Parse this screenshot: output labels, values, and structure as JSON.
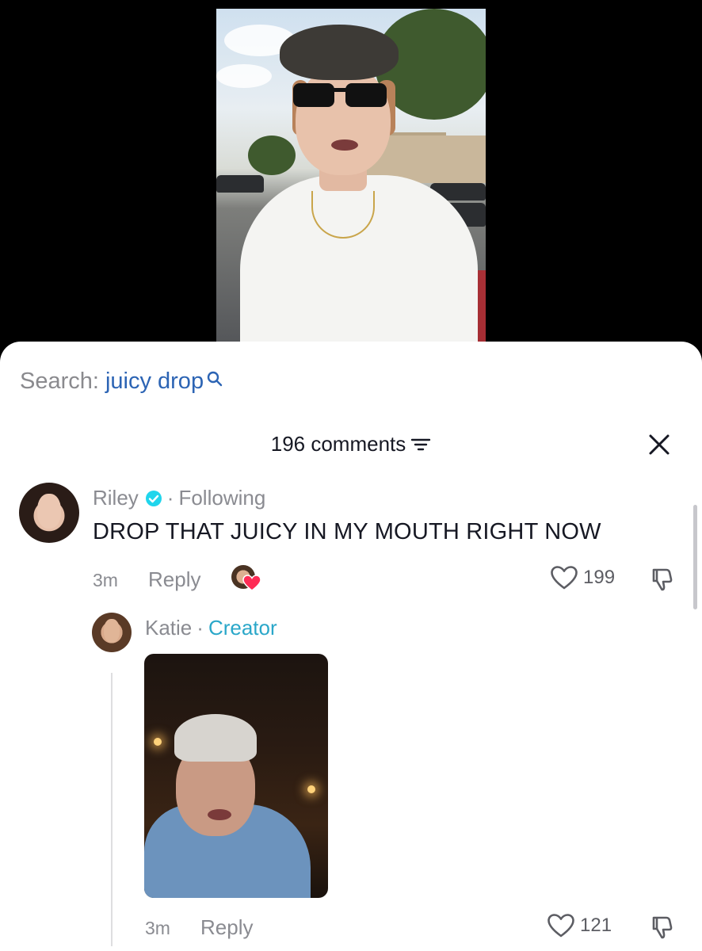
{
  "search": {
    "label": "Search:",
    "query": "juicy drop"
  },
  "comments_header": {
    "count_label": "196 comments"
  },
  "comments": [
    {
      "author": "Riley",
      "relation": "Following",
      "text": "DROP THAT JUICY IN MY MOUTH RIGHT NOW",
      "time": "3m",
      "reply_label": "Reply",
      "likes": "199"
    }
  ],
  "replies": [
    {
      "author": "Katie",
      "badge": "Creator",
      "time": "3m",
      "reply_label": "Reply",
      "likes": "121"
    }
  ],
  "separator": "·",
  "colors": {
    "search_query": "#2c64b4",
    "creator_badge": "#2aa7c9",
    "verified": "#20d5ec",
    "liked_heart": "#fe2c55"
  },
  "icons": {
    "search": "search-icon",
    "filter": "filter-icon",
    "close": "close-icon",
    "verified": "verified-badge-icon",
    "like": "heart-outline-icon",
    "dislike": "thumbs-down-icon"
  }
}
